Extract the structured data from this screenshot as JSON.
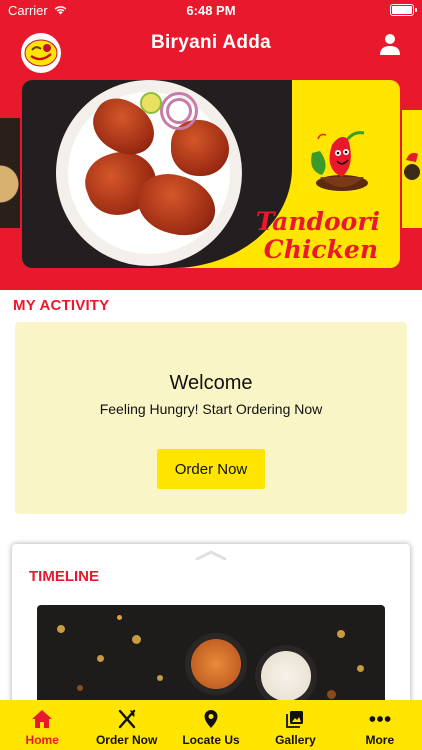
{
  "status_bar": {
    "carrier": "Carrier",
    "time": "6:48 PM"
  },
  "header": {
    "title": "Biryani Adda",
    "logo_icon": "biryani-adda-logo",
    "user_icon": "user-icon"
  },
  "carousel": {
    "active_slide": {
      "title_line1": "Tandoori",
      "title_line2": "Chicken"
    }
  },
  "my_activity": {
    "section_title": "MY ACTIVITY",
    "welcome_title": "Welcome",
    "welcome_subtitle": "Feeling Hungry! Start Ordering Now",
    "order_button": "Order Now"
  },
  "timeline": {
    "section_title": "TIMELINE"
  },
  "bottom_nav": {
    "items": [
      {
        "label": "Home",
        "icon": "home-icon",
        "active": true
      },
      {
        "label": "Order Now",
        "icon": "fork-knife-icon",
        "active": false
      },
      {
        "label": "Locate Us",
        "icon": "location-pin-icon",
        "active": false
      },
      {
        "label": "Gallery",
        "icon": "gallery-icon",
        "active": false
      },
      {
        "label": "More",
        "icon": "more-dots-icon",
        "active": false
      }
    ]
  },
  "colors": {
    "brand_red": "#e8192c",
    "brand_yellow": "#ffe500",
    "card_cream": "#f9f5c6"
  }
}
